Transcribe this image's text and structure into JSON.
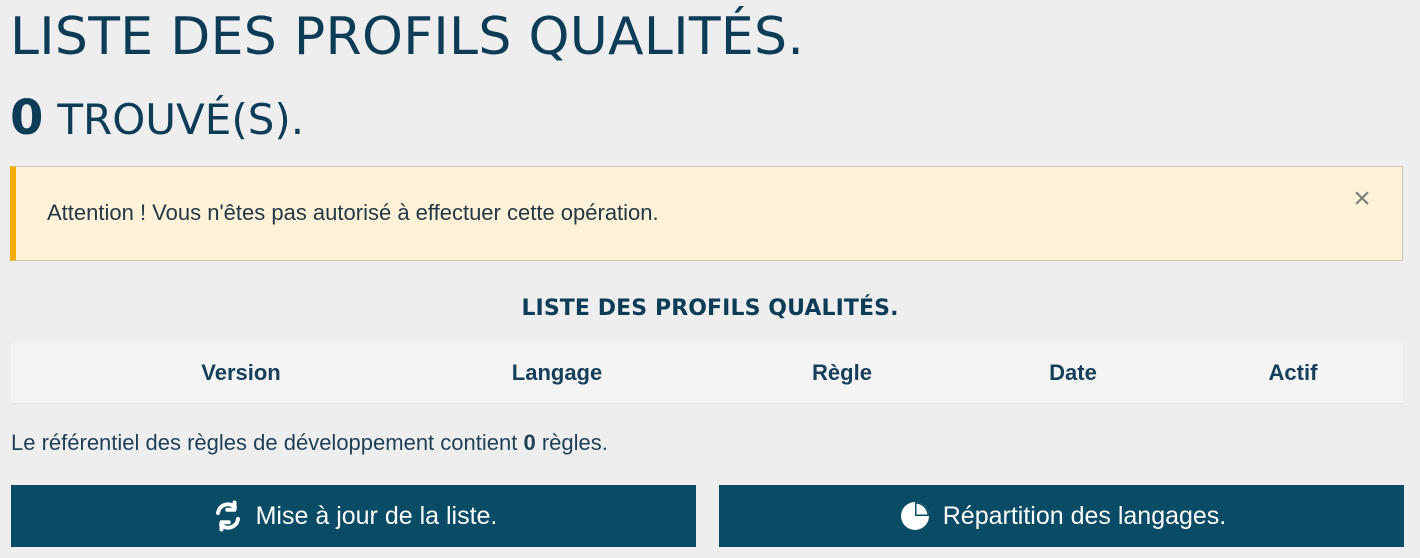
{
  "header": {
    "title": "LISTE DES PROFILS QUALITÉS.",
    "found_count": "0",
    "found_label": "TROUVÉ(S)."
  },
  "alert": {
    "message": "Attention ! Vous n'êtes pas autorisé à effectuer cette opération.",
    "close_symbol": "×",
    "colors": {
      "background": "#fff2d8",
      "accent": "#f2ad00"
    }
  },
  "section": {
    "caption": "LISTE DES PROFILS QUALITÉS."
  },
  "table": {
    "headers": [
      "Version",
      "Langage",
      "Règle",
      "Date",
      "Actif"
    ]
  },
  "summary": {
    "prefix": "Le référentiel des règles de développement contient ",
    "count": "0",
    "suffix": " règles."
  },
  "actions": [
    {
      "label": "Mise à jour de la liste.",
      "icon": "refresh-icon"
    },
    {
      "label": "Répartition des langages.",
      "icon": "pie-chart-icon"
    }
  ],
  "colors": {
    "page_background": "#eeeeee",
    "primary_text": "#0d3c57",
    "button_background": "#0a4b66"
  }
}
